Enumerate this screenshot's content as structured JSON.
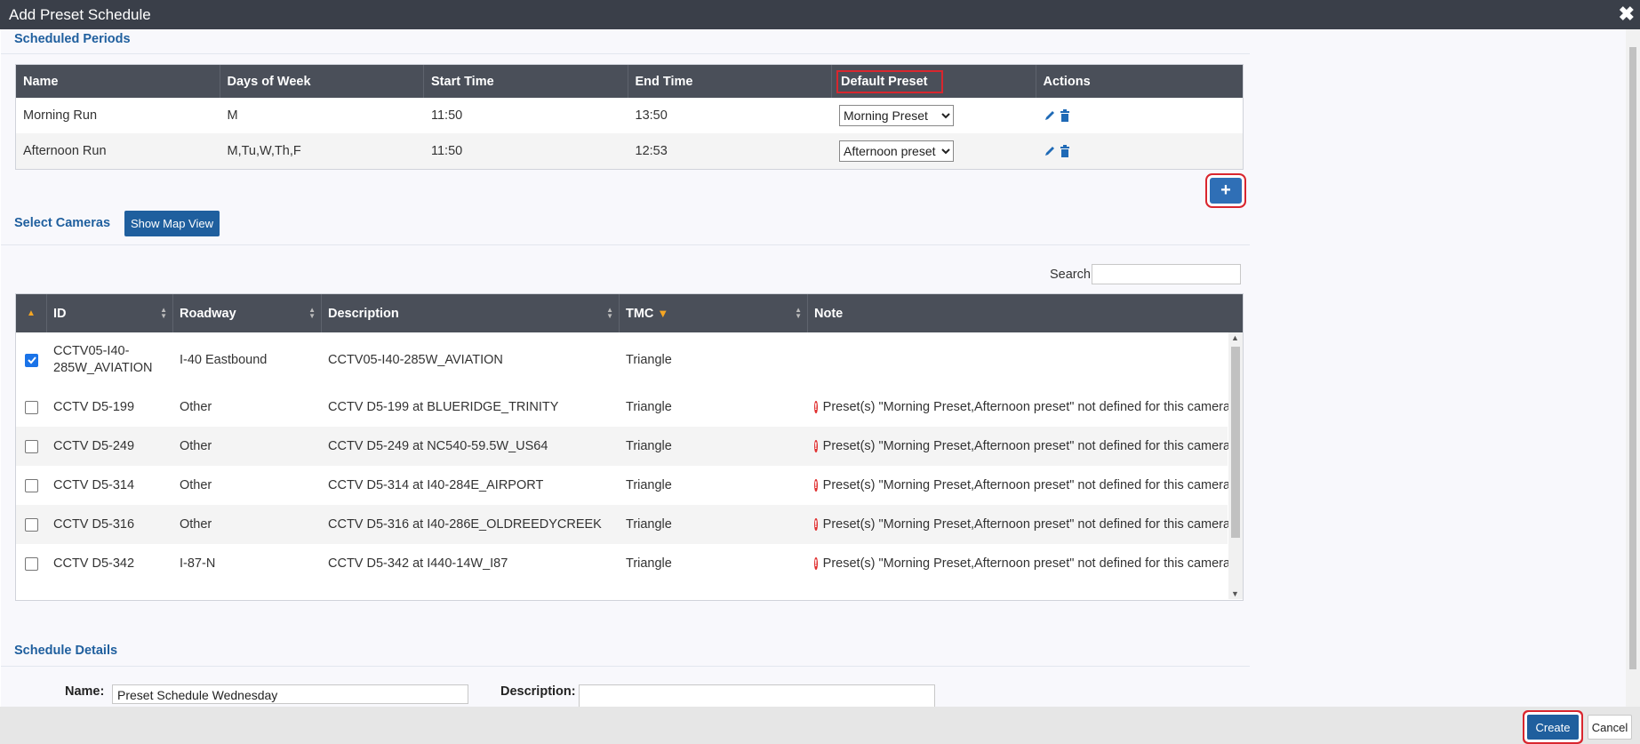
{
  "window": {
    "title": "Add Preset Schedule",
    "close_icon": "close-icon"
  },
  "periods": {
    "section_title": "Scheduled Periods",
    "columns": [
      "Name",
      "Days of Week",
      "Start Time",
      "End Time",
      "Default Preset",
      "Actions"
    ],
    "rows": [
      {
        "name": "Morning Run",
        "days": "M",
        "start": "11:50",
        "end": "13:50",
        "preset": "Morning Preset"
      },
      {
        "name": "Afternoon Run",
        "days": "M,Tu,W,Th,F",
        "start": "11:50",
        "end": "12:53",
        "preset": "Afternoon preset"
      }
    ],
    "add_icon": "plus-icon"
  },
  "cameras": {
    "section_title": "Select Cameras",
    "map_button": "Show Map View",
    "search_label": "Search",
    "search_value": "",
    "columns": [
      "ID",
      "Roadway",
      "Description",
      "TMC",
      "Note"
    ],
    "rows": [
      {
        "checked": true,
        "id": "CCTV05-I40-285W_AVIATION",
        "roadway": "I-40 Eastbound",
        "description": "CCTV05-I40-285W_AVIATION",
        "tmc": "Triangle",
        "note": ""
      },
      {
        "checked": false,
        "id": "CCTV D5-199",
        "roadway": "Other",
        "description": "CCTV D5-199 at BLUERIDGE_TRINITY",
        "tmc": "Triangle",
        "note": "Preset(s) \"Morning Preset,Afternoon preset\" not defined for this camera"
      },
      {
        "checked": false,
        "id": "CCTV D5-249",
        "roadway": "Other",
        "description": "CCTV D5-249 at NC540-59.5W_US64",
        "tmc": "Triangle",
        "note": "Preset(s) \"Morning Preset,Afternoon preset\" not defined for this camera"
      },
      {
        "checked": false,
        "id": "CCTV D5-314",
        "roadway": "Other",
        "description": "CCTV D5-314 at I40-284E_AIRPORT",
        "tmc": "Triangle",
        "note": "Preset(s) \"Morning Preset,Afternoon preset\" not defined for this camera"
      },
      {
        "checked": false,
        "id": "CCTV D5-316",
        "roadway": "Other",
        "description": "CCTV D5-316 at I40-286E_OLDREEDYCREEK",
        "tmc": "Triangle",
        "note": "Preset(s) \"Morning Preset,Afternoon preset\" not defined for this camera"
      },
      {
        "checked": false,
        "id": "CCTV D5-342",
        "roadway": "I-87-N",
        "description": "CCTV D5-342 at I440-14W_I87",
        "tmc": "Triangle",
        "note": "Preset(s) \"Morning Preset,Afternoon preset\" not defined for this camera"
      }
    ]
  },
  "details": {
    "section_title": "Schedule Details",
    "name_label": "Name:",
    "name_value": "Preset Schedule Wednesday",
    "description_label": "Description:",
    "description_value": ""
  },
  "footer": {
    "create_label": "Create",
    "cancel_label": "Cancel"
  },
  "colors": {
    "header_bg": "#4a4f59",
    "accent": "#1f5f9e",
    "highlight": "#d9262e"
  }
}
